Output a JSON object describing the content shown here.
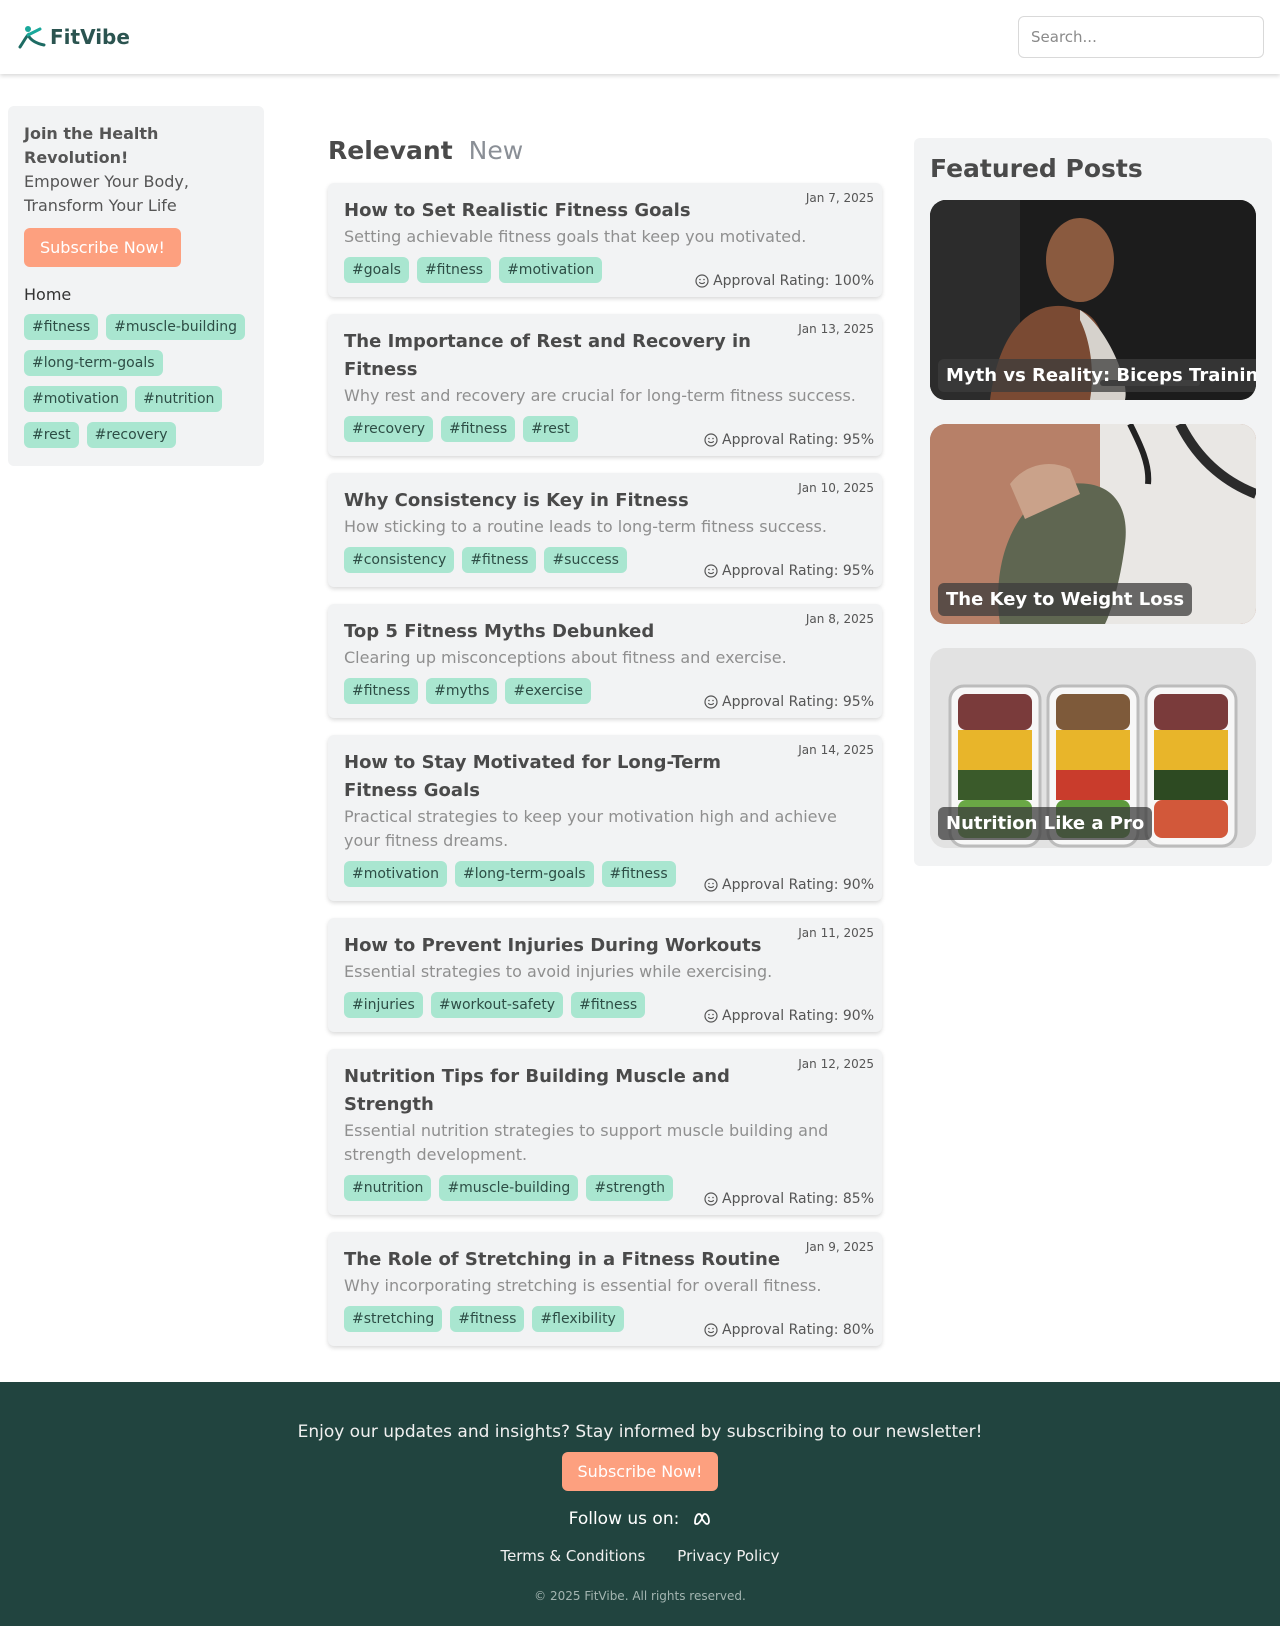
{
  "header": {
    "brand": "FitVibe",
    "search_placeholder": "Search..."
  },
  "sidebar": {
    "join_title": "Join the Health Revolution!",
    "join_subtitle": "Empower Your Body, Transform Your Life",
    "subscribe_label": "Subscribe Now!",
    "home_label": "Home",
    "tags": [
      "#fitness",
      "#muscle-building",
      "#long-term-goals",
      "#motivation",
      "#nutrition",
      "#rest",
      "#recovery"
    ]
  },
  "main": {
    "tabs": [
      {
        "label": "Relevant"
      },
      {
        "label": "New"
      }
    ],
    "posts": [
      {
        "title": "How to Set Realistic Fitness Goals",
        "desc": "Setting achievable fitness goals that keep you motivated.",
        "date": "Jan 7, 2025",
        "tags": [
          "#goals",
          "#fitness",
          "#motivation"
        ],
        "rating": "Approval Rating: 100%"
      },
      {
        "title": "The Importance of Rest and Recovery in Fitness",
        "desc": "Why rest and recovery are crucial for long-term fitness success.",
        "date": "Jan 13, 2025",
        "tags": [
          "#recovery",
          "#fitness",
          "#rest"
        ],
        "rating": "Approval Rating: 95%"
      },
      {
        "title": "Why Consistency is Key in Fitness",
        "desc": "How sticking to a routine leads to long-term fitness success.",
        "date": "Jan 10, 2025",
        "tags": [
          "#consistency",
          "#fitness",
          "#success"
        ],
        "rating": "Approval Rating: 95%"
      },
      {
        "title": "Top 5 Fitness Myths Debunked",
        "desc": "Clearing up misconceptions about fitness and exercise.",
        "date": "Jan 8, 2025",
        "tags": [
          "#fitness",
          "#myths",
          "#exercise"
        ],
        "rating": "Approval Rating: 95%"
      },
      {
        "title": "How to Stay Motivated for Long-Term Fitness Goals",
        "desc": "Practical strategies to keep your motivation high and achieve your fitness dreams.",
        "date": "Jan 14, 2025",
        "tags": [
          "#motivation",
          "#long-term-goals",
          "#fitness"
        ],
        "rating": "Approval Rating: 90%"
      },
      {
        "title": "How to Prevent Injuries During Workouts",
        "desc": "Essential strategies to avoid injuries while exercising.",
        "date": "Jan 11, 2025",
        "tags": [
          "#injuries",
          "#workout-safety",
          "#fitness"
        ],
        "rating": "Approval Rating: 90%"
      },
      {
        "title": "Nutrition Tips for Building Muscle and Strength",
        "desc": "Essential nutrition strategies to support muscle building and strength development.",
        "date": "Jan 12, 2025",
        "tags": [
          "#nutrition",
          "#muscle-building",
          "#strength"
        ],
        "rating": "Approval Rating: 85%"
      },
      {
        "title": "The Role of Stretching in a Fitness Routine",
        "desc": "Why incorporating stretching is essential for overall fitness.",
        "date": "Jan 9, 2025",
        "tags": [
          "#stretching",
          "#fitness",
          "#flexibility"
        ],
        "rating": "Approval Rating: 80%"
      }
    ]
  },
  "featured": {
    "title": "Featured Posts",
    "items": [
      {
        "caption": "Myth vs Reality: Biceps Training"
      },
      {
        "caption": "The Key to Weight Loss"
      },
      {
        "caption": "Nutrition Like a Pro"
      }
    ]
  },
  "footer": {
    "newsletter_text": "Enjoy our updates and insights? Stay informed by subscribing to our newsletter!",
    "subscribe_label": "Subscribe Now!",
    "follow_label": "Follow us on:",
    "social_icon": "meta-icon",
    "terms_label": "Terms & Conditions",
    "privacy_label": "Privacy Policy",
    "copyright": "© 2025 FitVibe. All rights reserved."
  },
  "colors": {
    "accent": "#fda07f",
    "tag_bg": "#a9e6d0",
    "footer_bg": "#21443f",
    "brand": "#2b5450"
  }
}
